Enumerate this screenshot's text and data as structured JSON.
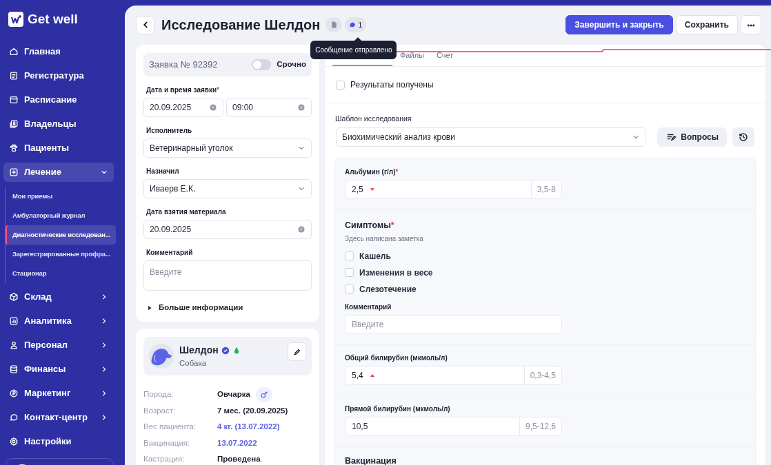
{
  "sidebar": {
    "logo": "Get well",
    "items": [
      {
        "label": "Главная",
        "selected": false
      },
      {
        "label": "Регистратура",
        "selected": false
      },
      {
        "label": "Расписание",
        "selected": false
      },
      {
        "label": "Владельцы",
        "selected": false
      },
      {
        "label": "Пациенты",
        "selected": false
      },
      {
        "label": "Лечение",
        "selected": true,
        "expanded": true,
        "children": [
          {
            "label": "Мои приемы",
            "selected": false
          },
          {
            "label": "Амбулаторный журнал",
            "selected": false
          },
          {
            "label": "Диагностические исследован...",
            "selected": true
          },
          {
            "label": "Зарегестрированные профра...",
            "selected": false
          },
          {
            "label": "Стационар",
            "selected": false
          }
        ]
      },
      {
        "label": "Склад",
        "selected": false,
        "expanded": false
      },
      {
        "label": "Аналитика",
        "selected": false,
        "expanded": false
      },
      {
        "label": "Персонал",
        "selected": false,
        "expanded": false
      },
      {
        "label": "Финансы",
        "selected": false,
        "expanded": false
      },
      {
        "label": "Маркетинг",
        "selected": false,
        "expanded": false
      },
      {
        "label": "Контакт-центр",
        "selected": false,
        "expanded": false
      },
      {
        "label": "Настройки",
        "selected": false
      }
    ]
  },
  "header": {
    "title": "Исследование Шелдон",
    "comment_count": "1",
    "tooltip": "Сообщение отправлено",
    "buttons": [
      {
        "label": "Завершить и закрыть",
        "kind": "primary"
      },
      {
        "label": "Сохранить",
        "kind": "secondary"
      },
      {
        "kind": "more"
      }
    ]
  },
  "request": {
    "number": "Заявка № 92392",
    "urgent": {
      "label": "Срочно",
      "on": false
    },
    "fields": [
      {
        "kind": "datetime",
        "label": "Дата и время заявки",
        "required_mark": "*",
        "date": "20.09.2025",
        "time": "09:00"
      },
      {
        "kind": "select",
        "label": "Исполнитель",
        "value": "Ветеринарный уголок"
      },
      {
        "kind": "select",
        "label": "Назначил",
        "value": "Иваерв Е.К."
      },
      {
        "kind": "date",
        "label": "Дата взятия материала",
        "value": "20.09.2025"
      },
      {
        "kind": "textarea",
        "label": "Комментарий",
        "placeholder": "Введите"
      }
    ],
    "more": {
      "label": "Больше информации",
      "expanded": false
    }
  },
  "patient": {
    "name": "Шелдон",
    "species": "Собака",
    "verified": true,
    "rows": [
      {
        "label": "Порода:",
        "value": "Овчарка",
        "link": false,
        "male": true
      },
      {
        "label": "Возраст:",
        "value": "7 мес. (20.09.2025)",
        "link": false
      },
      {
        "label": "Вес пациента:",
        "value": "4 кг. (13.07.2022)",
        "link": true
      },
      {
        "label": "Вакцинация:",
        "value": "13.07.2022",
        "link": true
      },
      {
        "label": "Кастрация:",
        "value": "Проведена",
        "link": false
      }
    ]
  },
  "study": {
    "tabs": [
      {
        "selected": true
      },
      {
        "label": "Файлы",
        "selected": false
      },
      {
        "label": "Счет",
        "selected": false
      }
    ],
    "results_received": {
      "label": "Результаты получены",
      "checked": false
    },
    "template": {
      "label": "Шаблон исследования",
      "value": "Биохимический анализ крови"
    },
    "questions_button": "Вопросы",
    "sections": [
      {
        "kind": "measure",
        "label": "Альбумин (г/л)",
        "required_mark": "*",
        "value": "2,5",
        "low": true,
        "high": false,
        "range": "3,5-8"
      },
      {
        "kind": "symptoms",
        "title": "Симптомы",
        "required_mark": "*",
        "note": "Здесь написана заметка",
        "options": [
          {
            "label": "Кашель",
            "checked": false
          },
          {
            "label": "Изменения в весе",
            "checked": false
          },
          {
            "label": "Слезотечение",
            "checked": false
          }
        ],
        "comment_label": "Комментарий",
        "comment_placeholder": "Введите"
      },
      {
        "kind": "measure",
        "label": "Общий билирубин (мкмоль/л)",
        "value": "5,4",
        "low": false,
        "high": true,
        "range": "0,3-4,5"
      },
      {
        "kind": "measure",
        "label": "Прямой билирубин (мкмоль/л)",
        "value": "10,5",
        "low": false,
        "high": false,
        "range": "9,5-12,6"
      },
      {
        "kind": "heading",
        "title": "Вакцинация"
      }
    ]
  }
}
